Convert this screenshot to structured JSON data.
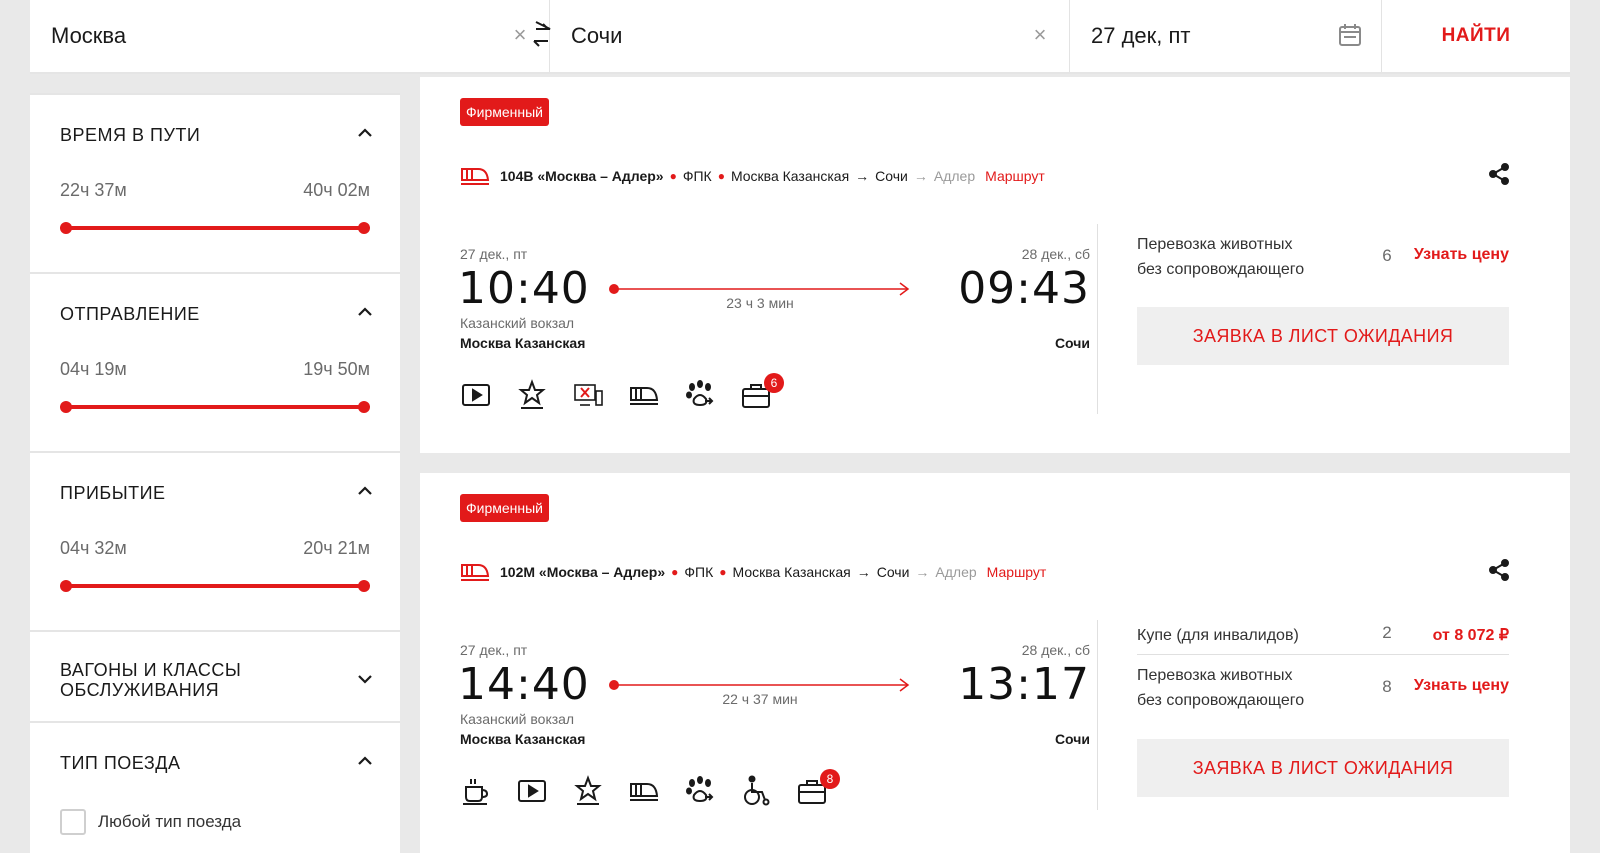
{
  "search": {
    "from": "Москва",
    "to": "Сочи",
    "date": "27 дек, пт",
    "find_label": "НАЙТИ"
  },
  "filters": {
    "travel_time": {
      "title": "ВРЕМЯ В ПУТИ",
      "min": "22ч 37м",
      "max": "40ч 02м"
    },
    "departure": {
      "title": "ОТПРАВЛЕНИЕ",
      "min": "04ч 19м",
      "max": "19ч 50м"
    },
    "arrival": {
      "title": "ПРИБЫТИЕ",
      "min": "04ч 32м",
      "max": "20ч 21м"
    },
    "wagons": {
      "title_line1": "ВАГОНЫ И КЛАССЫ",
      "title_line2": "ОБСЛУЖИВАНИЯ"
    },
    "train_type": {
      "title": "ТИП ПОЕЗДА",
      "option_any": "Любой тип поезда"
    }
  },
  "trains": [
    {
      "badge": "Фирменный",
      "name": "104В «Москва – Адлер»",
      "carrier": "ФПК",
      "route_from": "Москва Казанская",
      "route_to": "Сочи",
      "route_end": "Адлер",
      "route_link": "Маршрут",
      "dep_date": "27 дек., пт",
      "dep_time": "10:40",
      "arr_date": "28 дек., сб",
      "arr_time": "09:43",
      "duration": "23 ч 3 мин",
      "dep_station_sub": "Казанский вокзал",
      "dep_station": "Москва Казанская",
      "arr_station": "Сочи",
      "amenities": [
        "video-icon",
        "star-service-icon",
        "no-tv-icon",
        "train-class-icon",
        "pets-icon",
        "baggage-icon"
      ],
      "baggage_count": "6",
      "seats": [
        {
          "name_line1": "Перевозка животных",
          "name_line2": "без сопровождающего",
          "count": "6",
          "price": "Узнать цену"
        }
      ],
      "wait_label": "ЗАЯВКА В ЛИСТ ОЖИДАНИЯ"
    },
    {
      "badge": "Фирменный",
      "name": "102М «Москва – Адлер»",
      "carrier": "ФПК",
      "route_from": "Москва Казанская",
      "route_to": "Сочи",
      "route_end": "Адлер",
      "route_link": "Маршрут",
      "dep_date": "27 дек., пт",
      "dep_time": "14:40",
      "arr_date": "28 дек., сб",
      "arr_time": "13:17",
      "duration": "22 ч 37 мин",
      "dep_station_sub": "Казанский вокзал",
      "dep_station": "Москва Казанская",
      "arr_station": "Сочи",
      "amenities": [
        "food-icon",
        "video-icon",
        "star-service-icon",
        "train-class-icon",
        "pets-icon",
        "wheelchair-icon",
        "baggage-icon"
      ],
      "baggage_count": "8",
      "seats": [
        {
          "name": "Купе (для инвалидов)",
          "count": "2",
          "price": "от 8 072 ₽"
        },
        {
          "name_line1": "Перевозка животных",
          "name_line2": "без сопровождающего",
          "count": "8",
          "price": "Узнать цену"
        }
      ],
      "wait_label": "ЗАЯВКА В ЛИСТ ОЖИДАНИЯ"
    }
  ],
  "colors": {
    "accent": "#e21a1a",
    "background": "#e9e9e9",
    "card": "#ffffff",
    "muted": "#6b6b6b"
  }
}
